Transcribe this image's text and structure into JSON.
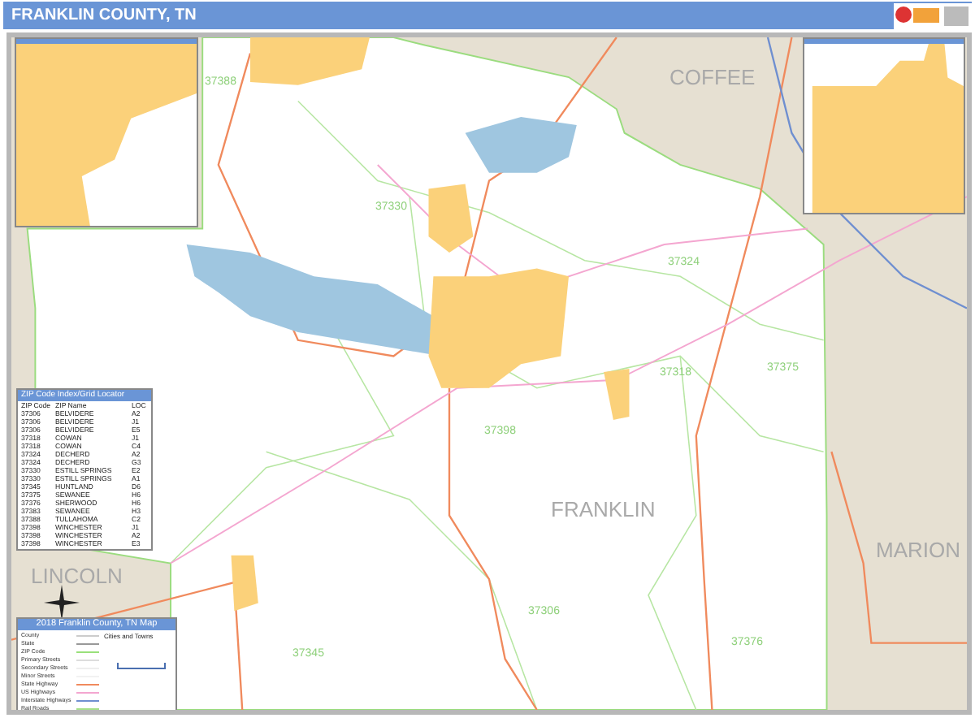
{
  "header": {
    "title": "FRANKLIN COUNTY, TN"
  },
  "map": {
    "county_labels": [
      "COFFEE",
      "MARION",
      "FRANKLIN",
      "LINCOLN"
    ],
    "zip_labels": [
      "37388",
      "37330",
      "37324",
      "37318",
      "37375",
      "37398",
      "37306",
      "37376",
      "37345"
    ]
  },
  "zip_index": {
    "title": "ZIP Code Index/Grid Locator",
    "columns": [
      "ZIP Code",
      "ZIP Name",
      "LOC"
    ],
    "rows": [
      [
        "37306",
        "BELVIDERE",
        "A2"
      ],
      [
        "37306",
        "BELVIDERE",
        "J1"
      ],
      [
        "37306",
        "BELVIDERE",
        "E5"
      ],
      [
        "37318",
        "COWAN",
        "J1"
      ],
      [
        "37318",
        "COWAN",
        "C4"
      ],
      [
        "37324",
        "DECHERD",
        "A2"
      ],
      [
        "37324",
        "DECHERD",
        "G3"
      ],
      [
        "37330",
        "ESTILL SPRINGS",
        "E2"
      ],
      [
        "37330",
        "ESTILL SPRINGS",
        "A1"
      ],
      [
        "37345",
        "HUNTLAND",
        "D6"
      ],
      [
        "37375",
        "SEWANEE",
        "H6"
      ],
      [
        "37376",
        "SHERWOOD",
        "H6"
      ],
      [
        "37383",
        "SEWANEE",
        "H3"
      ],
      [
        "37388",
        "TULLAHOMA",
        "C2"
      ],
      [
        "37398",
        "WINCHESTER",
        "J1"
      ],
      [
        "37398",
        "WINCHESTER",
        "A2"
      ],
      [
        "37398",
        "WINCHESTER",
        "E3"
      ]
    ]
  },
  "legend": {
    "title": "2018 Franklin County, TN Map",
    "cities_title": "Cities and Towns",
    "items": [
      {
        "label": "County",
        "color": "#cccccc"
      },
      {
        "label": "State",
        "color": "#999999"
      },
      {
        "label": "ZIP Code",
        "color": "#99e07a"
      },
      {
        "label": "Primary Streets",
        "color": "#dddddd"
      },
      {
        "label": "Secondary Streets",
        "color": "#eeeeee"
      },
      {
        "label": "Minor Streets",
        "color": "#f2f2f2"
      },
      {
        "label": "State Highway",
        "color": "#f08a5d"
      },
      {
        "label": "US Highways",
        "color": "#f4a6d0"
      },
      {
        "label": "Interstate Highways",
        "color": "#6f8fd0"
      },
      {
        "label": "Rail Roads",
        "color": "#a6e08a"
      }
    ]
  }
}
